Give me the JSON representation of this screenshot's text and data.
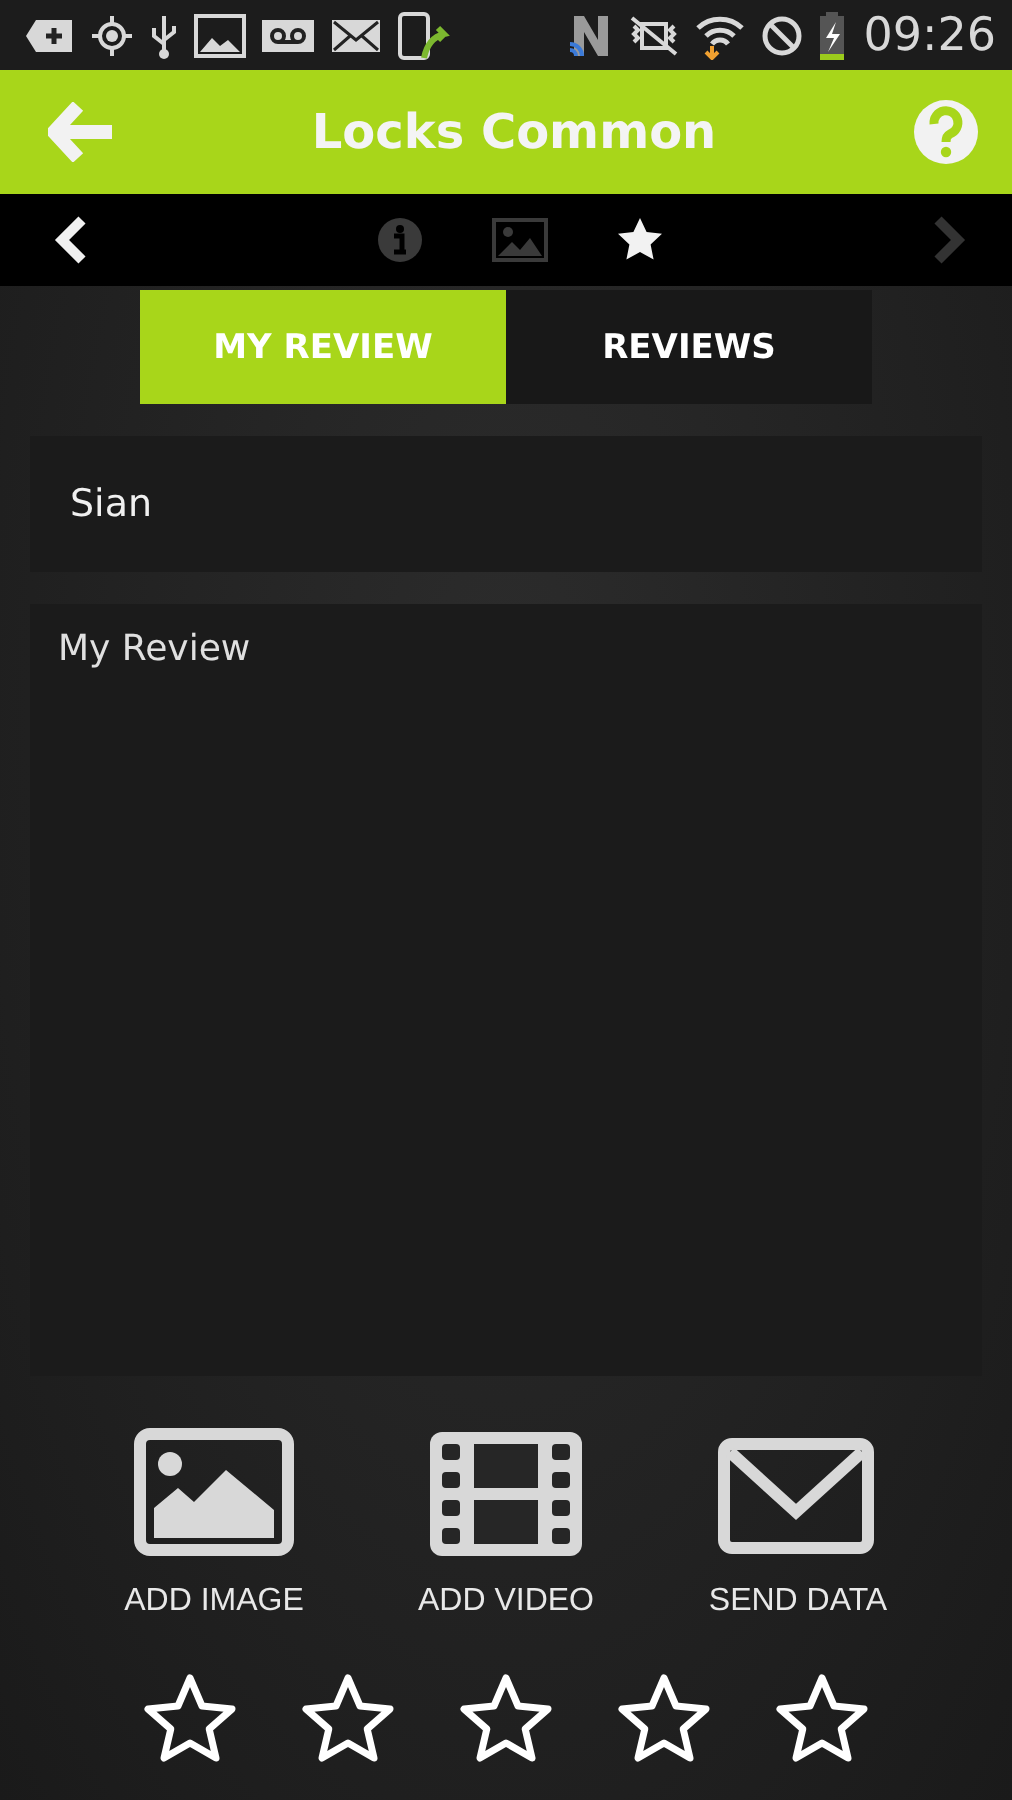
{
  "status_bar": {
    "time": "09:26"
  },
  "header": {
    "title": "Locks Common"
  },
  "section_nav": {
    "previous_disabled": false,
    "next_disabled": true,
    "sections": [
      {
        "kind": "info",
        "selected": false
      },
      {
        "kind": "image",
        "selected": false
      },
      {
        "kind": "star",
        "selected": true
      }
    ]
  },
  "tabs": [
    {
      "label": "MY REVIEW",
      "selected": true
    },
    {
      "label": "REVIEWS",
      "selected": false
    }
  ],
  "name_field": {
    "value": "Sian"
  },
  "review_field": {
    "placeholder": "My Review"
  },
  "actions": [
    {
      "kind": "image",
      "label": "ADD IMAGE"
    },
    {
      "kind": "video",
      "label": "ADD VIDEO"
    },
    {
      "kind": "mail",
      "label": "SEND DATA"
    }
  ],
  "rating": {
    "stars": 0
  }
}
